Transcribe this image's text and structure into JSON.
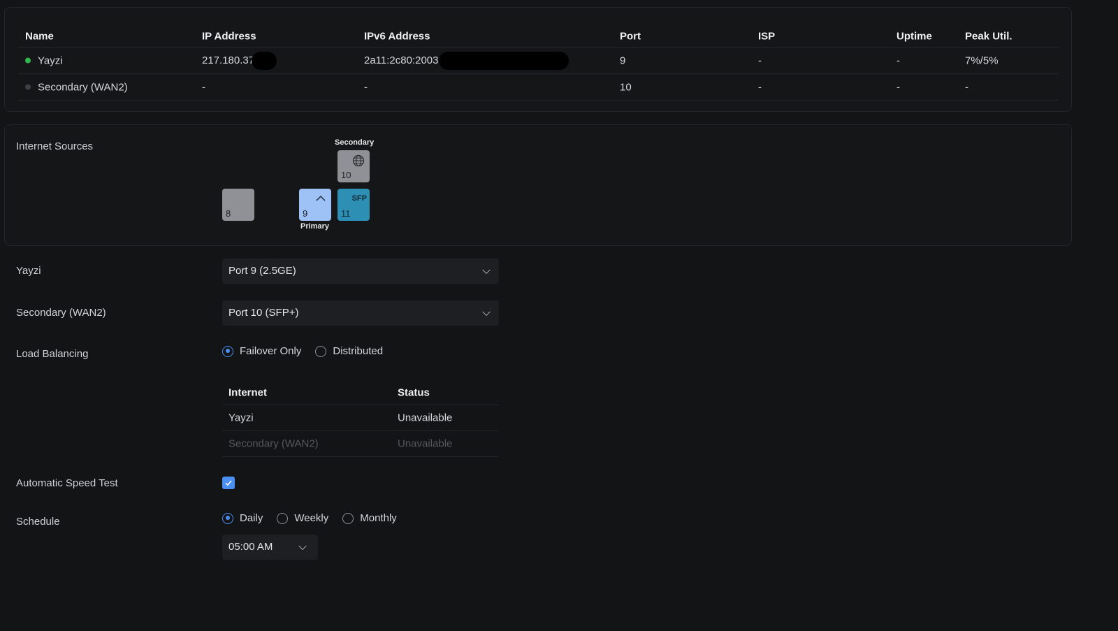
{
  "wan_table": {
    "headers": [
      "Name",
      "IP Address",
      "IPv6 Address",
      "Port",
      "ISP",
      "Uptime",
      "Peak Util."
    ],
    "rows": [
      {
        "name": "Yayzi",
        "status_color": "#2fb84f",
        "ip": "217.180.37",
        "ipv6": "2a11:2c80:2003:",
        "port": "9",
        "isp": "-",
        "uptime": "-",
        "peak": "7%/5%"
      },
      {
        "name": "Secondary (WAN2)",
        "status_color": "#3b3e43",
        "ip": "-",
        "ipv6": "-",
        "port": "10",
        "isp": "-",
        "uptime": "-",
        "peak": "-"
      }
    ]
  },
  "internet_sources": {
    "title": "Internet Sources",
    "ports": [
      {
        "num": "8",
        "color": "#8f9197"
      },
      {
        "num": "9",
        "color": "#9ec2f5",
        "label": "Primary",
        "icon": "chevron-up-icon"
      },
      {
        "num": "10",
        "color": "#8f9197",
        "label": "Secondary",
        "icon": "globe-icon"
      },
      {
        "num": "11",
        "color": "#2e8fb5",
        "badge": "SFP"
      }
    ]
  },
  "form": {
    "yayzi_label": "Yayzi",
    "yayzi_port": "Port 9 (2.5GE)",
    "secondary_label": "Secondary (WAN2)",
    "secondary_port": "Port 10 (SFP+)",
    "load_balancing_label": "Load Balancing",
    "load_options": [
      "Failover Only",
      "Distributed"
    ],
    "load_selected": "Failover Only",
    "status_table": {
      "headers": [
        "Internet",
        "Status"
      ],
      "rows": [
        {
          "internet": "Yayzi",
          "status": "Unavailable"
        },
        {
          "internet": "Secondary (WAN2)",
          "status": "Unavailable"
        }
      ]
    },
    "speed_test_label": "Automatic Speed Test",
    "speed_test_checked": true,
    "schedule_label": "Schedule",
    "schedule_options": [
      "Daily",
      "Weekly",
      "Monthly"
    ],
    "schedule_selected": "Daily",
    "schedule_time": "05:00 AM"
  },
  "colors": {
    "accent": "#4a8ff2",
    "online": "#2fb84f",
    "sfp": "#2e8fb5",
    "primary_port": "#9ec2f5"
  }
}
